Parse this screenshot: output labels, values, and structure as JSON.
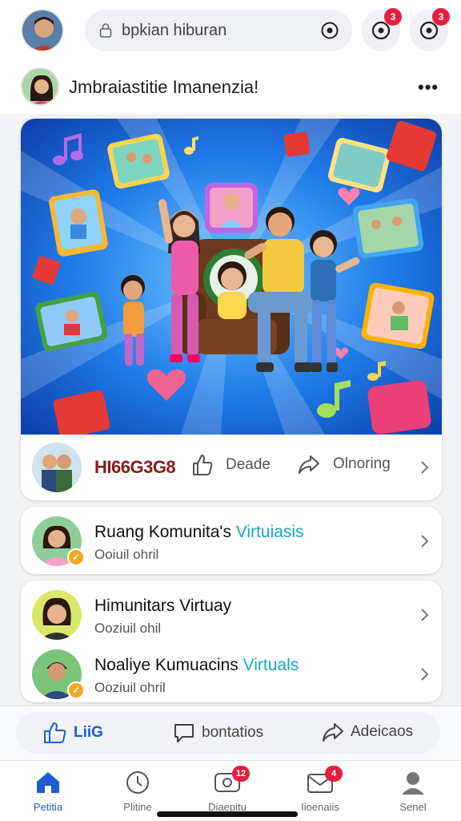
{
  "header": {
    "search_text": "bpkian hiburan",
    "notif_badge_1": "3",
    "notif_badge_2": "3"
  },
  "post": {
    "title": "Jmbraiastitie Imanenzia!",
    "more_label": "•••"
  },
  "actions": {
    "brand": "HI66G3G8",
    "like_label": "Deade",
    "share_label": "Olnoring"
  },
  "list_cards": [
    {
      "title_main": "Ruang Komunita's ",
      "title_accent": "Virtuiasis",
      "subtitle": "Ooiuil ohril"
    },
    {
      "title_main": "Himunitars Virtuay",
      "title_accent": "",
      "subtitle": "Ooziuil ohil"
    },
    {
      "title_main": "Noaliye Kumuacins ",
      "title_accent": "Virtuals",
      "subtitle": "Ooziuil ohril"
    }
  ],
  "reactions": {
    "like": "LiiG",
    "comment": "bontatios",
    "share": "Adeicaos"
  },
  "bottom_nav": [
    {
      "label": "Petitia",
      "icon": "home-icon",
      "active": true
    },
    {
      "label": "Plitine",
      "icon": "clock-icon"
    },
    {
      "label": "Diaepitu",
      "icon": "inbox-icon",
      "badge": "12"
    },
    {
      "label": "Iioenaiis",
      "icon": "envelope-icon",
      "badge": "4"
    },
    {
      "label": "Senel",
      "icon": "profile-icon"
    }
  ],
  "colors": {
    "accent_blue": "#1a5fd0",
    "accent_cyan": "#18a8c6",
    "badge_red": "#e41e3f",
    "hero_blue": "#1b6fe0"
  }
}
